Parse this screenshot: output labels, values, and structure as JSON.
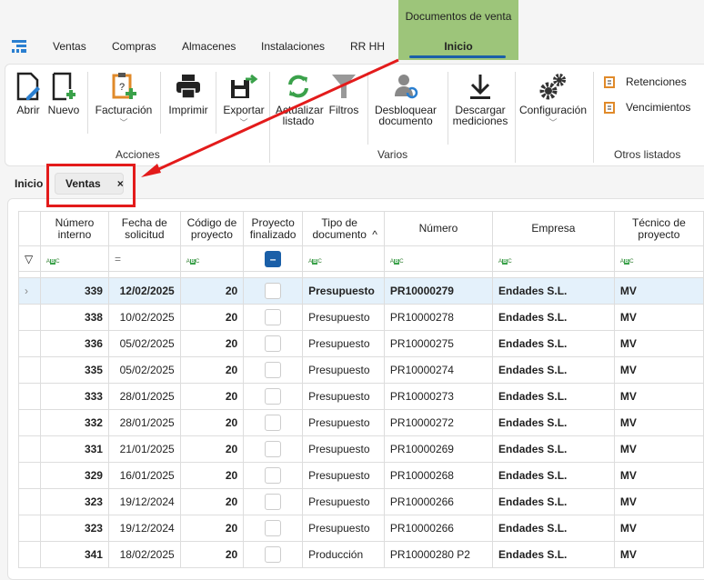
{
  "menu": {
    "tabs": [
      "Ventas",
      "Compras",
      "Almacenes",
      "Instalaciones",
      "RR HH"
    ],
    "context_title": "Documentos de venta",
    "context_tab": "Inicio"
  },
  "ribbon": {
    "abrir": "Abrir",
    "nuevo": "Nuevo",
    "facturacion": "Facturación",
    "imprimir": "Imprimir",
    "exportar": "Exportar",
    "actualizar": "Actualizar listado",
    "filtros": "Filtros",
    "desbloquear": "Desbloquear documento",
    "descargar": "Descargar mediciones",
    "configuracion": "Configuración",
    "retenciones": "Retenciones",
    "vencimientos": "Vencimientos",
    "groups": {
      "acciones": "Acciones",
      "varios": "Varios",
      "otros": "Otros listados"
    }
  },
  "breadcrumb": {
    "home": "Inicio",
    "tab": "Ventas",
    "close": "×"
  },
  "colors": {
    "accent": "#1a5fa8",
    "context_tab": "#9dc57a",
    "annotation": "#e31b1b",
    "selected_row": "#e4f1fb"
  },
  "grid": {
    "headers": [
      "Número interno",
      "Fecha de solicitud",
      "Código de proyecto",
      "Proyecto finalizado",
      "Tipo de documento",
      "Número",
      "Empresa",
      "Técnico de proyecto"
    ],
    "sort_indicator": "^",
    "filter_eq": "=",
    "rows": [
      [
        "339",
        "12/02/2025",
        "20",
        "",
        "Presupuesto",
        "PR10000279",
        "Endades S.L.",
        "MV"
      ],
      [
        "338",
        "10/02/2025",
        "20",
        "",
        "Presupuesto",
        "PR10000278",
        "Endades S.L.",
        "MV"
      ],
      [
        "336",
        "05/02/2025",
        "20",
        "",
        "Presupuesto",
        "PR10000275",
        "Endades S.L.",
        "MV"
      ],
      [
        "335",
        "05/02/2025",
        "20",
        "",
        "Presupuesto",
        "PR10000274",
        "Endades S.L.",
        "MV"
      ],
      [
        "333",
        "28/01/2025",
        "20",
        "",
        "Presupuesto",
        "PR10000273",
        "Endades S.L.",
        "MV"
      ],
      [
        "332",
        "28/01/2025",
        "20",
        "",
        "Presupuesto",
        "PR10000272",
        "Endades S.L.",
        "MV"
      ],
      [
        "331",
        "21/01/2025",
        "20",
        "",
        "Presupuesto",
        "PR10000269",
        "Endades S.L.",
        "MV"
      ],
      [
        "329",
        "16/01/2025",
        "20",
        "",
        "Presupuesto",
        "PR10000268",
        "Endades S.L.",
        "MV"
      ],
      [
        "323",
        "19/12/2024",
        "20",
        "",
        "Presupuesto",
        "PR10000266",
        "Endades S.L.",
        "MV"
      ],
      [
        "323",
        "19/12/2024",
        "20",
        "",
        "Presupuesto",
        "PR10000266",
        "Endades S.L.",
        "MV"
      ],
      [
        "341",
        "18/02/2025",
        "20",
        "",
        "Producción",
        "PR10000280 P2",
        "Endades S.L.",
        "MV"
      ]
    ]
  }
}
